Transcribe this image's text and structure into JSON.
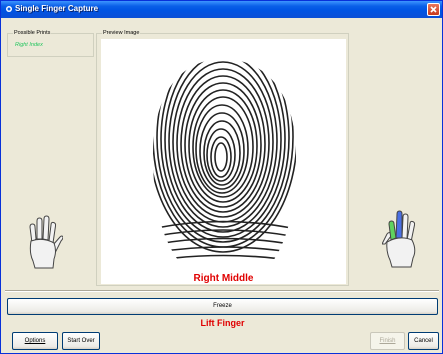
{
  "window": {
    "title": "Single Finger Capture"
  },
  "possible_prints": {
    "label": "Possible Prints",
    "items": [
      "Right Index"
    ]
  },
  "preview": {
    "label": "Preview Image",
    "finger_label": "Right Middle"
  },
  "freeze_button": "Freeze",
  "status": "Lift Finger",
  "buttons": {
    "options": "Options",
    "start_over": "Start Over",
    "finish": "Finish",
    "cancel": "Cancel"
  },
  "colors": {
    "title_bar": "#0054e3",
    "status": "#e00000",
    "possible_print": "#22c55e",
    "highlight_green": "#5fd35f",
    "highlight_blue": "#4a6fe3"
  },
  "icons": [
    "app-icon",
    "close-icon",
    "left-hand-icon",
    "right-hand-icon",
    "fingerprint-image"
  ]
}
